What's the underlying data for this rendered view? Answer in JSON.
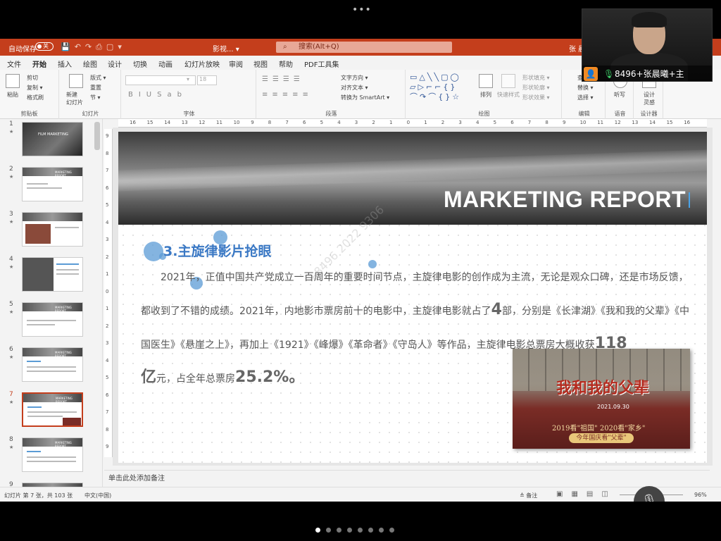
{
  "meeting": {
    "participant": "8496+张晨曦+主",
    "pages": 9,
    "active_page": 1
  },
  "ppt": {
    "autosave_label": "自动保存",
    "autosave_state": "关",
    "doc_name": "影视... ▾",
    "search_placeholder": "搜索(Alt+Q)",
    "user": "张 晨",
    "tabs": [
      "文件",
      "开始",
      "插入",
      "绘图",
      "设计",
      "切换",
      "动画",
      "幻灯片放映",
      "审阅",
      "视图",
      "帮助",
      "PDF工具集"
    ],
    "active_tab": "开始",
    "ribbon": {
      "clipboard": {
        "paste": "粘贴",
        "cut": "剪切",
        "copy": "复制 ▾",
        "format_painter": "格式刷",
        "label": "剪贴板"
      },
      "slides": {
        "new_slide": "新建\n幻灯片",
        "layout": "版式 ▾",
        "reset": "重置",
        "section": "节 ▾",
        "label": "幻灯片"
      },
      "font": {
        "size": "18",
        "label": "字体"
      },
      "paragraph": {
        "text_direction": "文字方向 ▾",
        "align_text": "对齐文本 ▾",
        "smartart": "转换为 SmartArt ▾",
        "label": "段落"
      },
      "drawing": {
        "arrange": "排列",
        "quick_styles": "快速样式",
        "fill": "形状填充 ▾",
        "outline": "形状轮廓 ▾",
        "effects": "形状效果 ▾",
        "label": "绘图"
      },
      "editing": {
        "find": "查找",
        "replace": "替换 ▾",
        "select": "选择 ▾",
        "label": "编辑"
      },
      "voice": {
        "dictate": "听写",
        "label": "语音"
      },
      "designer": {
        "design_ideas": "设计\n灵感",
        "label": "设计器"
      }
    },
    "slide_count_label": "幻灯片 第 7 张，共 103 张",
    "language": "中文(中国)",
    "notes_button": "备注",
    "zoom": "96%",
    "notes_placeholder": "单击此处添加备注",
    "thumbnails": [
      {
        "num": "1",
        "label": "FILM MARKETING"
      },
      {
        "num": "2",
        "label": "MARKETING REPORT"
      },
      {
        "num": "3",
        "label": ""
      },
      {
        "num": "4",
        "label": ""
      },
      {
        "num": "5",
        "label": "MARKETING REPORT"
      },
      {
        "num": "6",
        "label": "MARKETING REPORT"
      },
      {
        "num": "7",
        "label": "MARKETING REPORT"
      },
      {
        "num": "8",
        "label": "MARKETING REPORT"
      },
      {
        "num": "9",
        "label": ""
      }
    ],
    "selected_thumbnail": "7"
  },
  "slide": {
    "banner_title": "MARKETING REPORT",
    "heading": "3.主旋律影片抢眼",
    "body_1": "2021年，正值中国共产党成立一百周年的重要时间节点，主旋律电影的创作成为主流，无论是观众口碑，还是市场反馈，都收到了不错的成绩。2021年，内地影市票房前十的电影中，主旋律电影就占了",
    "num_4": "4",
    "body_2": "部，分别是《长津湖》《我和我的父辈》《中国医生》《悬崖之上》，再加上《1921》《峰爆》《革命者》《守岛人》等作品，主旋律电影总票房大概收获",
    "num_118": "118",
    "num_yi": "亿",
    "body_3": "元，占全年总票房",
    "num_pct": "25.2%",
    "body_end": "。",
    "poster": {
      "title": "我和我的父辈",
      "date": "2021.09.30",
      "line1": "2019看\"祖国\" 2020看\"家乡\"",
      "line2": "今年国庆看\"父辈\""
    }
  }
}
